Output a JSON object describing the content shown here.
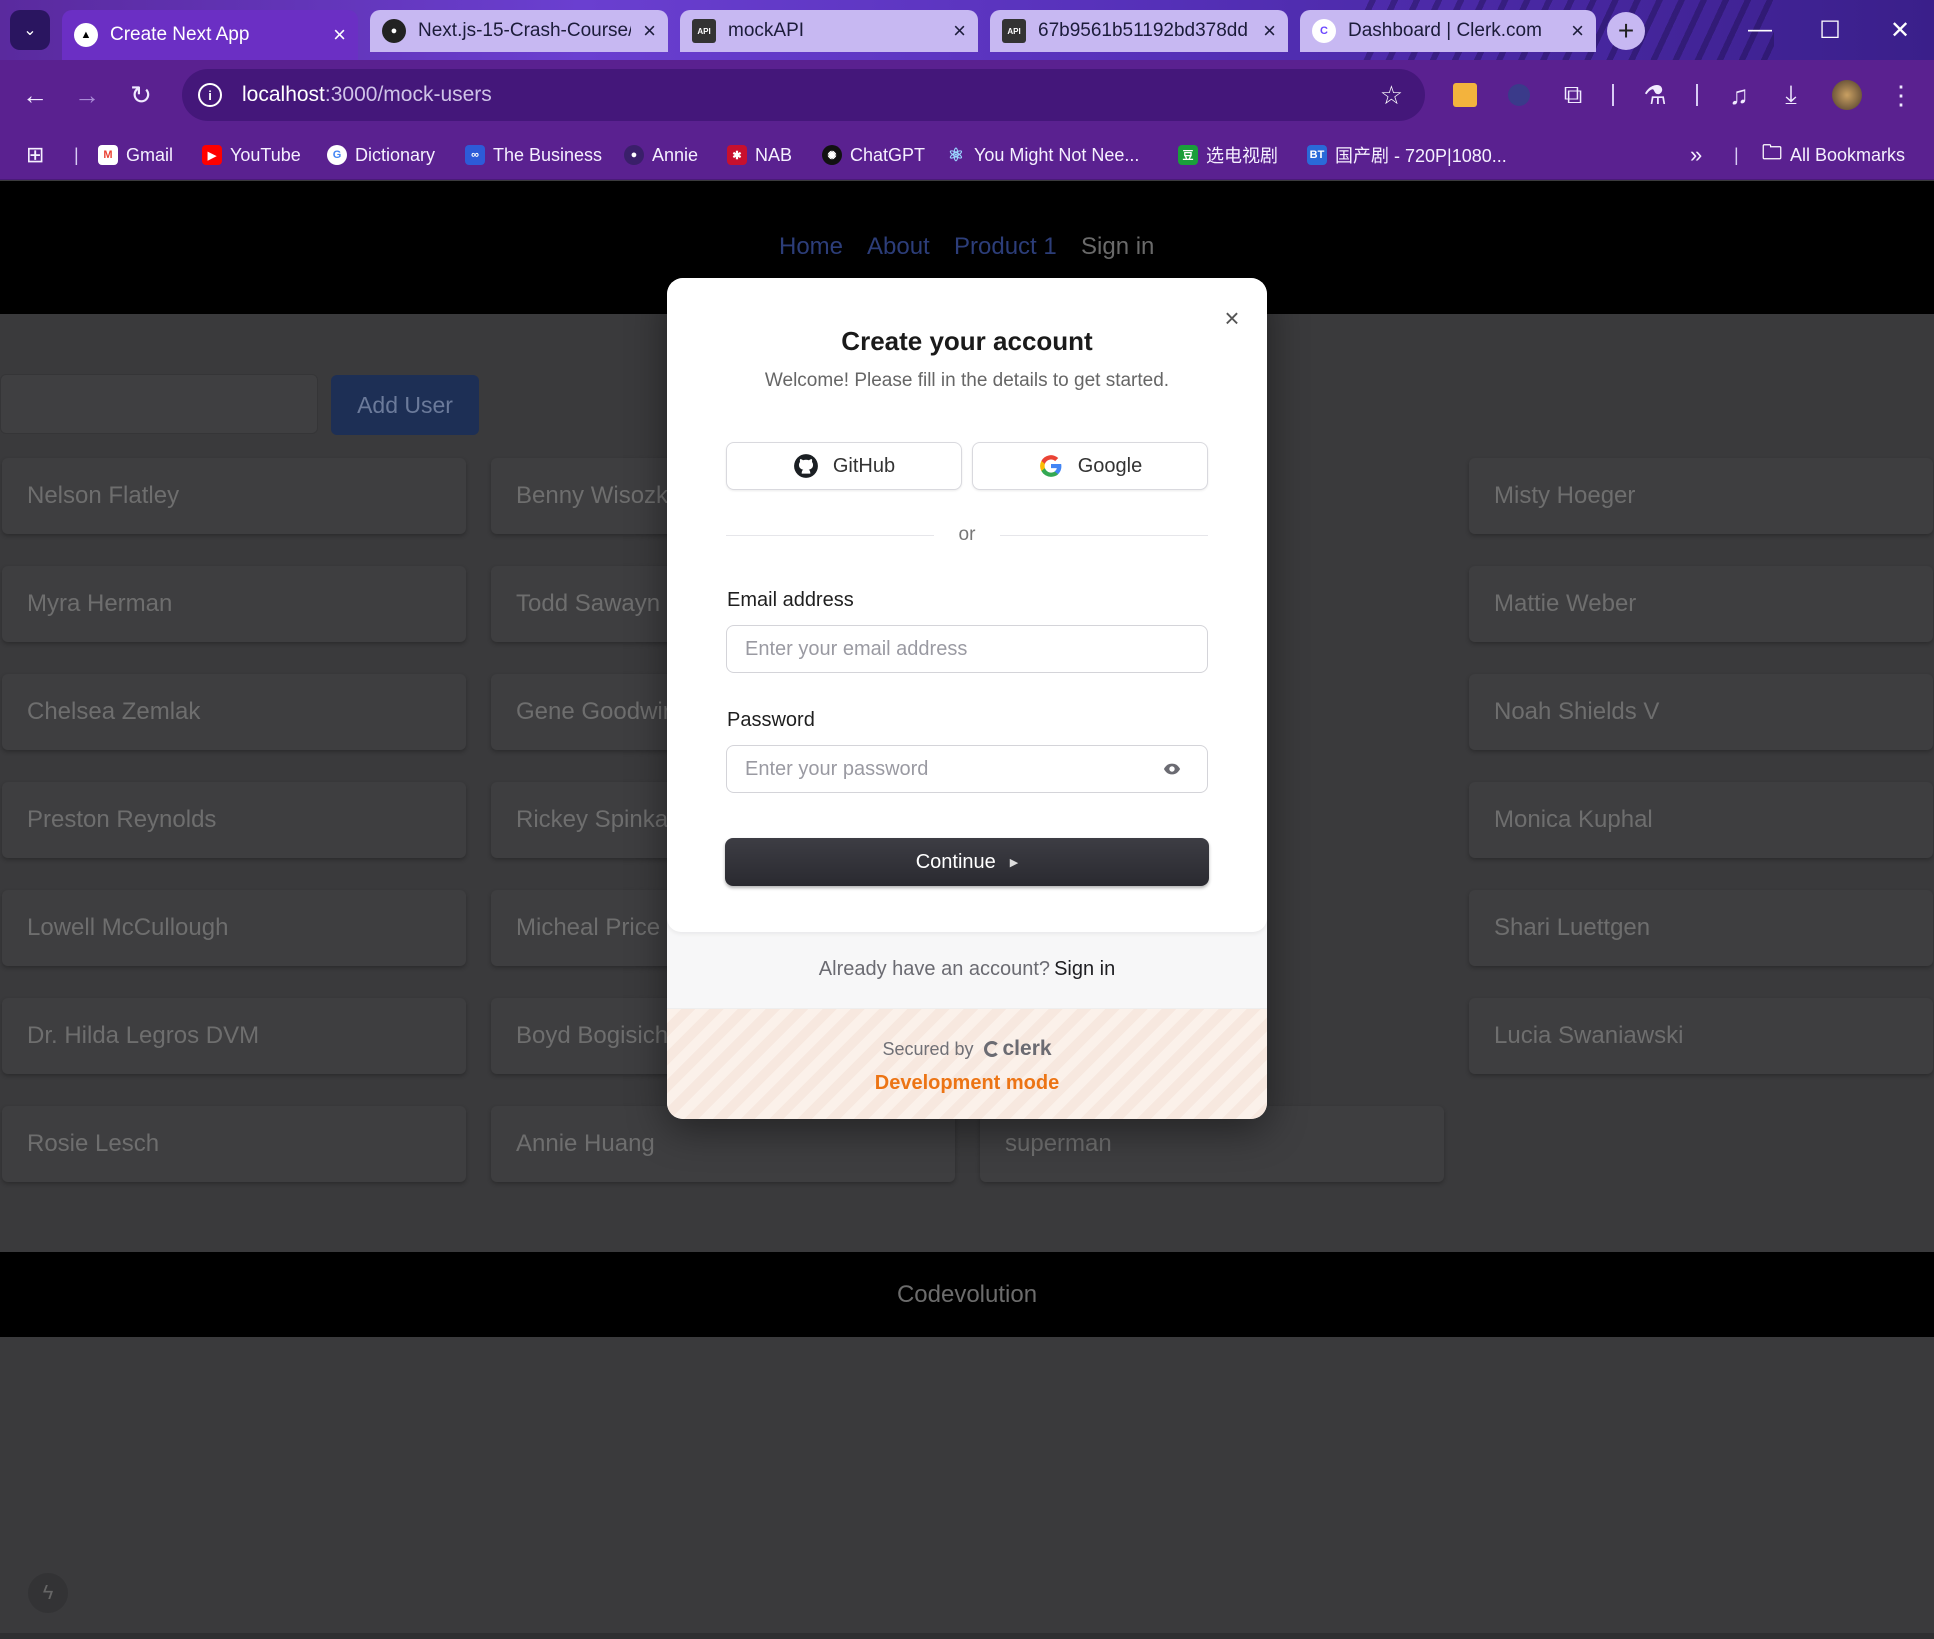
{
  "tabs": [
    {
      "title": "Create Next App",
      "icon": "nextjs-icon"
    },
    {
      "title": "Next.js-15-Crash-Course/",
      "icon": "github-icon"
    },
    {
      "title": "mockAPI",
      "icon": "mockapi-icon"
    },
    {
      "title": "67b9561b51192bd378dd",
      "icon": "mockapi-icon"
    },
    {
      "title": "Dashboard | Clerk.com",
      "icon": "clerk-icon"
    }
  ],
  "address": {
    "host": "localhost",
    "path": ":3000/mock-users"
  },
  "bookmarks": [
    {
      "label": "Gmail"
    },
    {
      "label": "YouTube"
    },
    {
      "label": "Dictionary"
    },
    {
      "label": "The Business"
    },
    {
      "label": "Annie"
    },
    {
      "label": "NAB"
    },
    {
      "label": "ChatGPT"
    },
    {
      "label": "You Might Not Nee..."
    },
    {
      "label": "选电视剧"
    },
    {
      "label": "国产剧 - 720P|1080..."
    }
  ],
  "all_bookmarks": "All Bookmarks",
  "nav": {
    "home": "Home",
    "about": "About",
    "product": "Product 1",
    "signin": "Sign in"
  },
  "add_user": "Add User",
  "users": {
    "col1": [
      "Nelson Flatley",
      "Myra Herman",
      "Chelsea Zemlak",
      "Preston Reynolds",
      "Lowell McCullough",
      "Dr. Hilda Legros DVM",
      "Rosie Lesch"
    ],
    "col2": [
      "Benny Wisozk",
      "Todd Sawayn",
      "Gene Goodwin",
      "Rickey Spinka",
      "Micheal Price",
      "Boyd Bogisich",
      "Annie Huang"
    ],
    "col3": [
      "superman"
    ],
    "col4": [
      "Misty Hoeger",
      "Mattie Weber",
      "Noah Shields V",
      "Monica Kuphal",
      "Shari Luettgen",
      "Lucia Swaniawski"
    ]
  },
  "footer": "Codevolution",
  "modal": {
    "title": "Create your account",
    "subtitle": "Welcome! Please fill in the details to get started.",
    "github": "GitHub",
    "google": "Google",
    "or": "or",
    "email_label": "Email address",
    "email_placeholder": "Enter your email address",
    "password_label": "Password",
    "password_placeholder": "Enter your password",
    "continue": "Continue",
    "already": "Already have an account?",
    "signin": "Sign in",
    "secured_by": "Secured by",
    "clerk": "clerk",
    "dev_mode": "Development mode"
  }
}
